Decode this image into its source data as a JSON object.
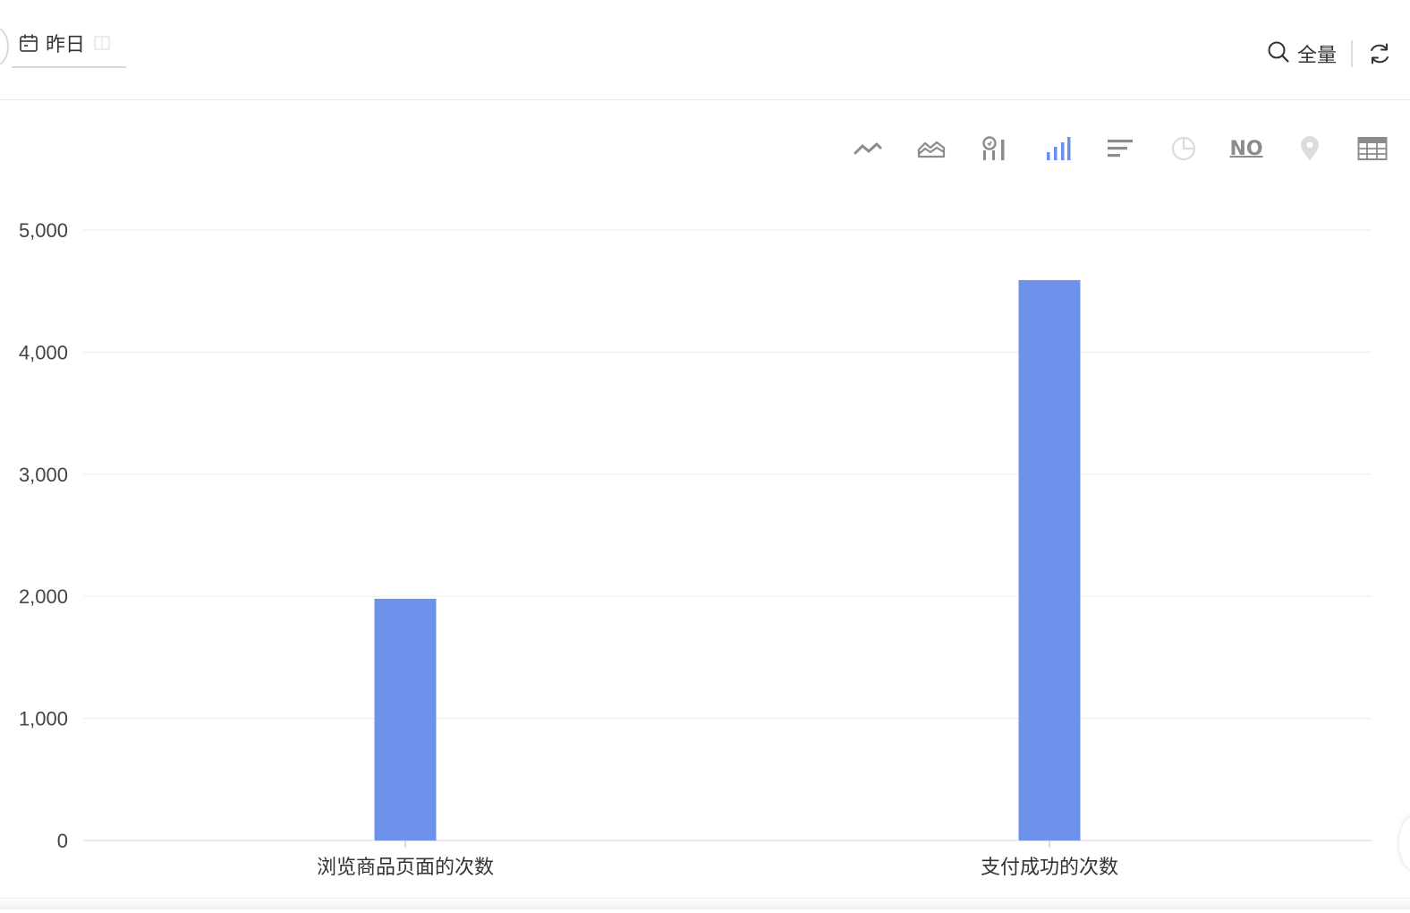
{
  "filter_bar": {
    "date_label": "昨日",
    "scope_label": "全量"
  },
  "chart_toolbar": {
    "items": [
      {
        "name": "line-chart-icon",
        "active": false,
        "enabled": true
      },
      {
        "name": "area-chart-icon",
        "active": false,
        "enabled": true
      },
      {
        "name": "combo-chart-icon",
        "active": false,
        "enabled": true
      },
      {
        "name": "bar-chart-icon",
        "active": true,
        "enabled": true
      },
      {
        "name": "horizontal-bar-chart-icon",
        "active": false,
        "enabled": true
      },
      {
        "name": "pie-chart-icon",
        "active": false,
        "enabled": false
      },
      {
        "name": "number-card-icon",
        "active": false,
        "enabled": true,
        "text": "NO"
      },
      {
        "name": "map-pin-icon",
        "active": false,
        "enabled": false
      },
      {
        "name": "table-icon",
        "active": false,
        "enabled": true
      }
    ],
    "colors": {
      "active": "#6b8fea",
      "normal": "#8c8c8c",
      "disabled": "#dcdcdc"
    }
  },
  "chart_data": {
    "type": "bar",
    "categories": [
      "浏览商品页面的次数",
      "支付成功的次数"
    ],
    "values": [
      1980,
      4590
    ],
    "ylim": [
      0,
      5000
    ],
    "yticks": [
      0,
      1000,
      2000,
      3000,
      4000,
      5000
    ],
    "ytick_labels": [
      "0",
      "1,000",
      "2,000",
      "3,000",
      "4,000",
      "5,000"
    ],
    "grid": true,
    "bar_color": "#6e91eb",
    "title": "",
    "xlabel": "",
    "ylabel": ""
  }
}
